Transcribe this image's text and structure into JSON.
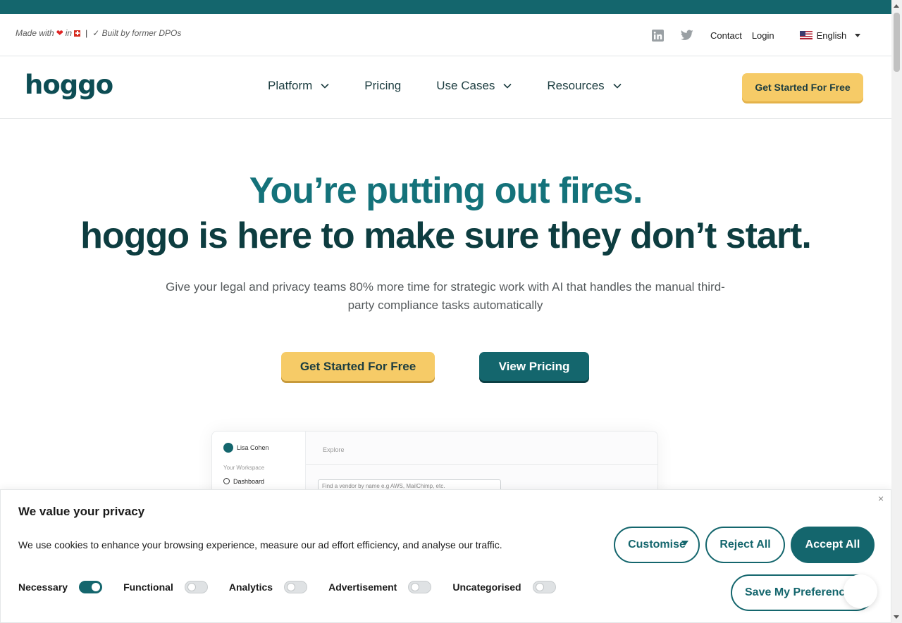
{
  "announcement": {
    "made_with": "Made with",
    "in": "in",
    "built_by": "✓ Built by former DPOs"
  },
  "topbar": {
    "contact": "Contact",
    "login": "Login",
    "language": "English"
  },
  "nav": {
    "logo": "hoggo",
    "items": [
      {
        "label": "Platform",
        "has_dropdown": true
      },
      {
        "label": "Pricing",
        "has_dropdown": false
      },
      {
        "label": "Use Cases",
        "has_dropdown": true
      },
      {
        "label": "Resources",
        "has_dropdown": true
      }
    ],
    "cta": "Get Started For Free"
  },
  "hero": {
    "headline_1": "You’re putting out fires.",
    "headline_2": "hoggo is here to make sure they don’t start.",
    "subtitle": "Give your legal and privacy teams 80% more time for strategic work with AI that handles the manual third-party compliance tasks automatically",
    "cta_primary": "Get Started For Free",
    "cta_secondary": "View Pricing"
  },
  "preview": {
    "user_name": "Lisa Cohen",
    "workspace": "Your Workspace",
    "dashboard": "Dashboard",
    "explore": "Explore",
    "search_placeholder": "Find a vendor by name e.g AWS, MailChimp, etc."
  },
  "cookie": {
    "title": "We value your privacy",
    "text": "We use cookies to enhance your browsing experience, measure our ad effort efficiency, and analyse our traffic.",
    "toggles": [
      {
        "label": "Necessary",
        "on": true
      },
      {
        "label": "Functional",
        "on": false
      },
      {
        "label": "Analytics",
        "on": false
      },
      {
        "label": "Advertisement",
        "on": false
      },
      {
        "label": "Uncategorised",
        "on": false
      }
    ],
    "customise": "Customise",
    "reject": "Reject All",
    "accept": "Accept All",
    "save": "Save My Preferences",
    "close": "×"
  },
  "colors": {
    "brand_teal": "#14666d",
    "brand_yellow": "#f6cb67",
    "dark_text": "#0d3d40"
  }
}
